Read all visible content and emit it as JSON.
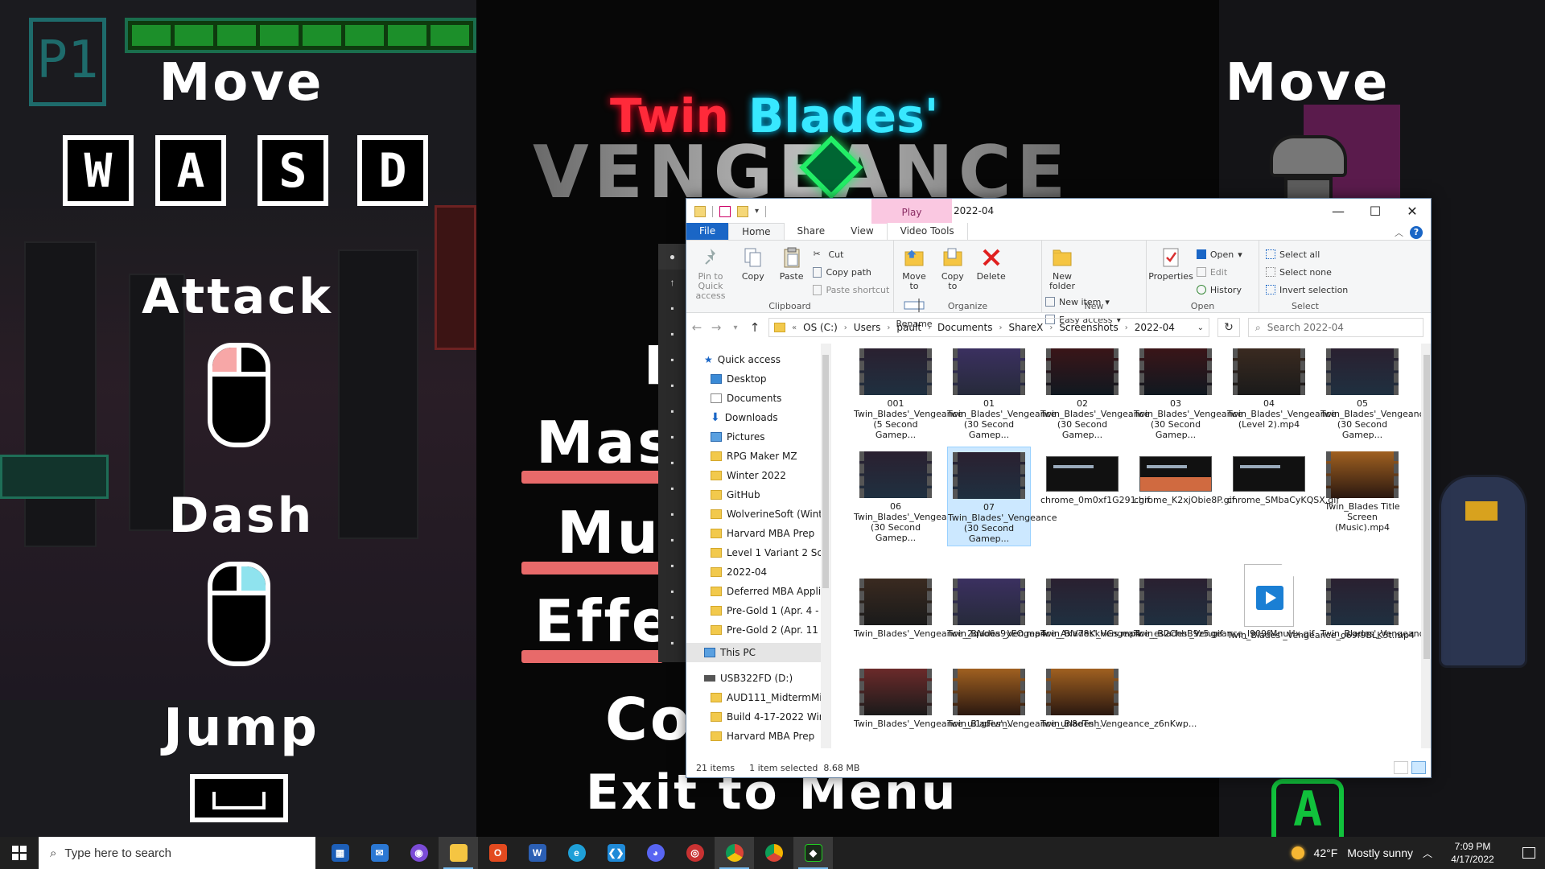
{
  "game": {
    "player_tag": "P1",
    "left_controls": {
      "move_label": "Move",
      "keys": [
        "W",
        "A",
        "S",
        "D"
      ],
      "attack_label": "Attack",
      "dash_label": "Dash",
      "jump_label": "Jump"
    },
    "title_line1_red": "Twin",
    "title_line1_cyan": "Blades'",
    "title_main": "VENGEANCE",
    "menu": {
      "item_p": "P",
      "item_master": "Mas",
      "item_music": "Mus",
      "item_effects": "Effe",
      "item_controls": "Co",
      "exit": "Exit to Menu"
    },
    "right_controls": {
      "move_label": "Move",
      "a_button": "A"
    },
    "colors": {
      "title_red": "#ff2a3a",
      "title_cyan": "#38e8ff",
      "gem_green": "#22ee66",
      "slider_pink": "#e86a6a",
      "mouse_attack": "#f7a7a7",
      "mouse_dash": "#8fe3ee"
    }
  },
  "explorer": {
    "window_title": "2022-04",
    "contextual_tab": "Play",
    "tabs": [
      "File",
      "Home",
      "Share",
      "View",
      "Video Tools"
    ],
    "active_tab": "Home",
    "ribbon": {
      "clipboard": {
        "label": "Clipboard",
        "pin": "Pin to Quick access",
        "copy": "Copy",
        "paste": "Paste",
        "cut": "Cut",
        "copy_path": "Copy path",
        "paste_shortcut": "Paste shortcut"
      },
      "organize": {
        "label": "Organize",
        "move_to": "Move to",
        "copy_to": "Copy to",
        "delete": "Delete",
        "rename": "Rename"
      },
      "new": {
        "label": "New",
        "new_folder": "New folder",
        "new_item": "New item",
        "easy_access": "Easy access"
      },
      "open": {
        "label": "Open",
        "properties": "Properties",
        "open": "Open",
        "edit": "Edit",
        "history": "History"
      },
      "select": {
        "label": "Select",
        "select_all": "Select all",
        "select_none": "Select none",
        "invert": "Invert selection"
      }
    },
    "breadcrumb": [
      "OS (C:)",
      "Users",
      "pault",
      "Documents",
      "ShareX",
      "Screenshots",
      "2022-04"
    ],
    "search_placeholder": "Search 2022-04",
    "nav": {
      "quick_access": "Quick access",
      "pinned": [
        "Desktop",
        "Documents",
        "Downloads",
        "Pictures",
        "RPG Maker MZ",
        "Winter 2022",
        "GitHub",
        "WolverineSoft (Winte",
        "Harvard MBA Prep",
        "Level 1 Variant 2 Scer"
      ],
      "recent": [
        "2022-04",
        "Deferred MBA Applicati",
        "Pre-Gold 1 (Apr. 4 - Apr",
        "Pre-Gold 2 (Apr. 11 - 19,"
      ],
      "this_pc": "This PC",
      "drive": "USB322FD (D:)",
      "drive_items": [
        "AUD111_MidtermMix_Y",
        "Build 4-17-2022 Windo",
        "Harvard MBA Prep"
      ]
    },
    "files": [
      {
        "name": "001 Twin_Blades'_Vengeance (5 Second Gamep..."
      },
      {
        "name": "01 Twin_Blades'_Vengeance (30 Second Gamep..."
      },
      {
        "name": "02 Twin_Blades'_Vengeance (30 Second Gamep..."
      },
      {
        "name": "03 Twin_Blades'_Vengeance (30 Second Gamep..."
      },
      {
        "name": "04 Twin_Blades'_Vengeance (Level 2).mp4"
      },
      {
        "name": "05 Twin_Blades'_Vengeance (30 Second Gamep..."
      },
      {
        "name": "06 Twin_Blades'_Vengeance (30 Second Gamep..."
      },
      {
        "name": "07 Twin_Blades'_Vengeance (30 Second Gamep..."
      },
      {
        "name": "chrome_0m0xf1G291.gif"
      },
      {
        "name": "chrome_K2xjObie8P.gif"
      },
      {
        "name": "chrome_SMbaCyKQSX.gif"
      },
      {
        "name": "Twin_Blades Title Screen (Music).mp4"
      },
      {
        "name": "Twin_Blades'_Vengeance_2qVo6a9yEO.mp4"
      },
      {
        "name": "Twin_Blades'_Vengeance_AxV78KkHGs.mp4"
      },
      {
        "name": "Twin_Blades'_Vengeance_es2ChhB9z5.gif"
      },
      {
        "name": "Twin_Blades'_Vengeance_l909fMnuHx.gif"
      },
      {
        "name": "Twin_Blades'_Vengeance_o69f9BLK5t.mp4"
      },
      {
        "name": "Twin_Blades'_Vengeance_ttMM5AyZB1.gif"
      },
      {
        "name": "Twin_Blades'_Vengeance_ui1gFivm..."
      },
      {
        "name": "Twin_Blades'_Vengeance_un8eTnh..."
      },
      {
        "name": "Twin_Blades'_Vengeance_z6nKwp..."
      }
    ],
    "selected_index": 7,
    "status": {
      "count": "21 items",
      "selection": "1 item selected",
      "size": "8.68 MB"
    }
  },
  "taskbar": {
    "search_placeholder": "Type here to search",
    "weather_temp": "42°F",
    "weather_text": "Mostly sunny",
    "time": "7:09 PM",
    "date": "4/17/2022"
  }
}
